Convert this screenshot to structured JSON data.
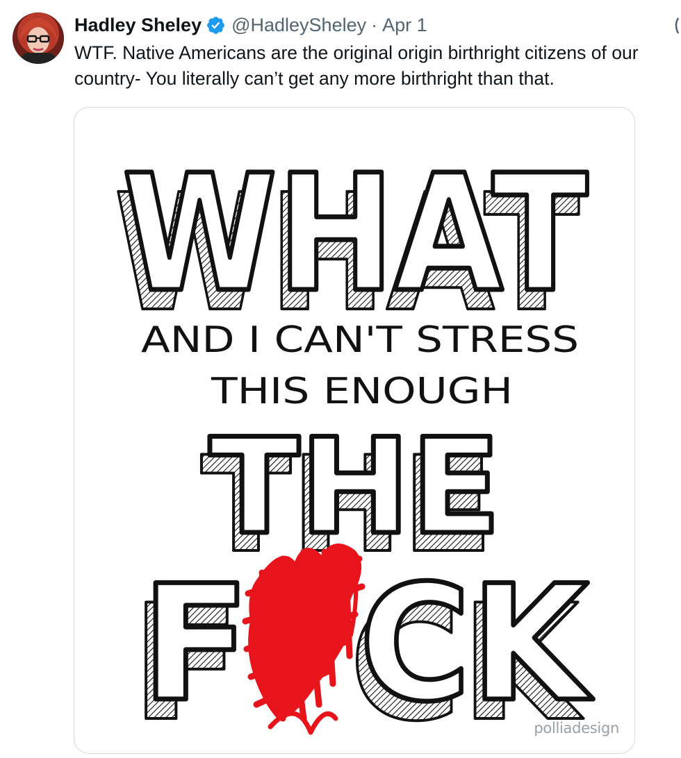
{
  "tweet": {
    "author_name": "Hadley Sheley",
    "handle": "@HadleySheley",
    "separator": "·",
    "date": "Apr 1",
    "text": "WTF. Native Americans are the original origin birthright citizens of our country- You literally can’t get any more birthright than that."
  },
  "media": {
    "line1": "WHAT",
    "line2": "AND I CAN'T STRESS",
    "line3": "THIS ENOUGH",
    "line4": "THE",
    "line5_left": "F",
    "line5_right": "CK",
    "watermark": "polliadesign"
  },
  "icons": {
    "avatar": "profile-photo",
    "verified": "verified-badge-icon",
    "more": "more-options-icon",
    "scribble": "red-scribble-censor"
  },
  "colors": {
    "verified_blue": "#1d9bf0",
    "scribble_red": "#e8141b",
    "secondary_text": "#536471"
  }
}
